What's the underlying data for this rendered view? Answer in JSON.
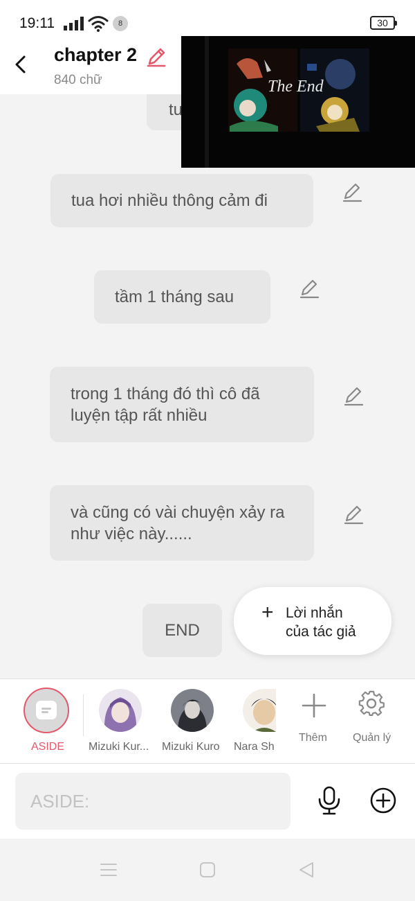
{
  "status_bar": {
    "time": "19:11",
    "notification_count": "8",
    "battery": "30"
  },
  "header": {
    "title": "chapter 2",
    "word_count": "840 chữ"
  },
  "messages": [
    {
      "text": "tu"
    },
    {
      "text": "tua hơi nhiều thông cảm đi"
    },
    {
      "text": "tầm 1 tháng sau"
    },
    {
      "text": "trong 1 tháng đó thì cô đã luyện tập rất nhiều"
    },
    {
      "text": "và cũng có vài chuyện xảy ra như việc này......"
    },
    {
      "text": "END"
    }
  ],
  "video": {
    "caption": "The End"
  },
  "author_note": {
    "line1": "Lời nhắn",
    "line2": "của tác giả"
  },
  "characters": [
    {
      "name": "ASIDE"
    },
    {
      "name": "Mizuki Kur..."
    },
    {
      "name": "Mizuki Kuro"
    },
    {
      "name": "Nara Sh"
    }
  ],
  "tools": {
    "add_label": "Thêm",
    "manage_label": "Quản lý"
  },
  "composer": {
    "placeholder": "ASIDE:"
  },
  "colors": {
    "accent": "#e5576a",
    "bubble": "#e7e7e7",
    "background": "#f3f3f3"
  }
}
